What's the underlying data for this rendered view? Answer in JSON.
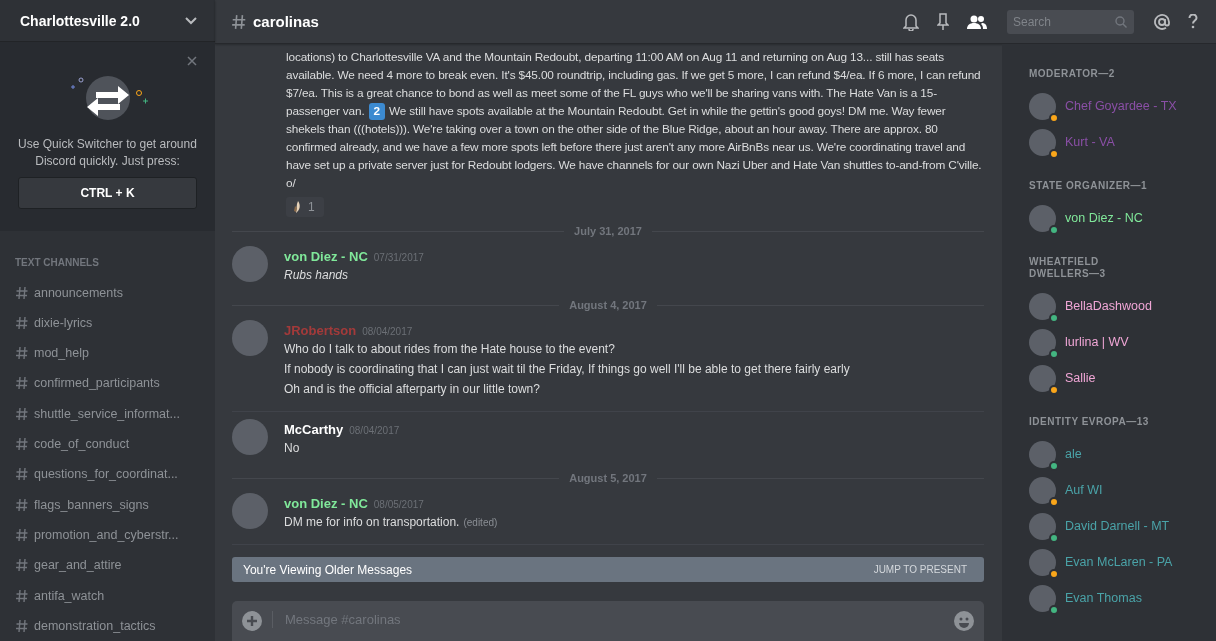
{
  "server": {
    "name": "Charlottesville 2.0"
  },
  "quick_switcher": {
    "text": "Use Quick Switcher to get around Discord quickly. Just press:",
    "shortcut": "CTRL + K"
  },
  "channels": {
    "heading": "TEXT CHANNELS",
    "items": [
      {
        "name": "announcements"
      },
      {
        "name": "dixie-lyrics"
      },
      {
        "name": "mod_help"
      },
      {
        "name": "confirmed_participants"
      },
      {
        "name": "shuttle_service_informat..."
      },
      {
        "name": "code_of_conduct"
      },
      {
        "name": "questions_for_coordinat..."
      },
      {
        "name": "flags_banners_signs"
      },
      {
        "name": "promotion_and_cyberstr..."
      },
      {
        "name": "gear_and_attire"
      },
      {
        "name": "antifa_watch"
      },
      {
        "name": "demonstration_tactics"
      }
    ]
  },
  "channel_header": {
    "name": "carolinas",
    "search": {
      "placeholder": "Search"
    }
  },
  "messages": [
    {
      "kind": "continuation",
      "parts": [
        {
          "kind": "text",
          "text": "locations) to Charlottesville VA and the Mountain Redoubt, departing 11:00 AM on Aug 11 and returning on Aug 13... still has seats available. We need 4 more to break even. It's $45.00 roundtrip, including gas. If we get 5 more, I can refund $4/ea. If 6 more, I can refund $7/ea. This is a great chance to bond as well as meet some of the FL guys who we'll be sharing vans with. The Hate Van is a 15-passenger van."
        },
        {
          "kind": "badge",
          "text": "2"
        },
        {
          "kind": "text",
          "text": "We still have spots available at the Mountain Redoubt. Get in while the gettin's good goys! DM me. Way fewer shekels than (((hotels))). We're taking over a town on the other side of the Blue Ridge, about an hour away. There are approx. 80 confirmed already, and we have a few more spots left before there just aren't any more AirBnBs near us. We're coordinating travel and have set up a private server just for Redoubt lodgers. We have channels for our own Nazi Uber and Hate Van shuttles to-and-from C'ville. o/"
        }
      ],
      "reaction": {
        "count": "1"
      }
    },
    {
      "kind": "divider",
      "text": "July 31, 2017"
    },
    {
      "kind": "message",
      "author": "von Diez - NC",
      "color": "#80e89a",
      "timestamp": "07/31/2017",
      "lines": [
        {
          "text": "Rubs hands",
          "italic": true
        }
      ]
    },
    {
      "kind": "divider",
      "text": "August 4, 2017"
    },
    {
      "kind": "message",
      "author": "JRobertson",
      "color": "#a33a3a",
      "timestamp": "08/04/2017",
      "lines": [
        {
          "text": "Who do I talk to about rides from the Hate house to the event?",
          "italic": false
        },
        {
          "text": "If nobody is coordinating that I can just wait til the Friday, If things go well I'll be able to get there fairly early",
          "italic": false
        },
        {
          "text": "Oh and is the official afterparty in our little town?",
          "italic": false
        }
      ]
    },
    {
      "kind": "message",
      "author": "McCarthy",
      "color": "#ffffff",
      "timestamp": "08/04/2017",
      "lines": [
        {
          "text": "No",
          "italic": false
        }
      ]
    },
    {
      "kind": "divider",
      "text": "August 5, 2017"
    },
    {
      "kind": "message",
      "author": "von Diez - NC",
      "color": "#80e89a",
      "timestamp": "08/05/2017",
      "lines": [
        {
          "text": "DM me for info on transportation.",
          "italic": false,
          "edited": "(edited)"
        }
      ]
    }
  ],
  "older_bar": {
    "text": "You're Viewing Older Messages",
    "action": "JUMP TO PRESENT"
  },
  "composer": {
    "placeholder": "Message #carolinas"
  },
  "member_groups": [
    {
      "heading": "MODERATOR—2",
      "color": "#8a4fa6",
      "members": [
        {
          "name": "Chef Goyardee - TX",
          "color": "#faa61a"
        },
        {
          "name": "Kurt - VA",
          "color": "#faa61a"
        }
      ]
    },
    {
      "heading": "STATE ORGANIZER—1",
      "color": "#80e89a",
      "members": [
        {
          "name": "von Diez - NC",
          "color": "#43b581"
        }
      ]
    },
    {
      "heading": "WHEATFIELD DWELLERS—3",
      "color": "#f0a6d6",
      "members": [
        {
          "name": "BellaDashwood",
          "color": "#43b581"
        },
        {
          "name": "lurlina | WV",
          "color": "#43b581"
        },
        {
          "name": "Sallie",
          "color": "#faa61a"
        }
      ]
    },
    {
      "heading": "IDENTITY EVROPA—13",
      "color": "#4aa3a8",
      "members": [
        {
          "name": "ale",
          "color": "#43b581"
        },
        {
          "name": "Auf WI",
          "color": "#faa61a"
        },
        {
          "name": "David Darnell - MT",
          "color": "#43b581"
        },
        {
          "name": "Evan McLaren - PA",
          "color": "#faa61a"
        },
        {
          "name": "Evan Thomas",
          "color": "#43b581"
        }
      ]
    }
  ]
}
